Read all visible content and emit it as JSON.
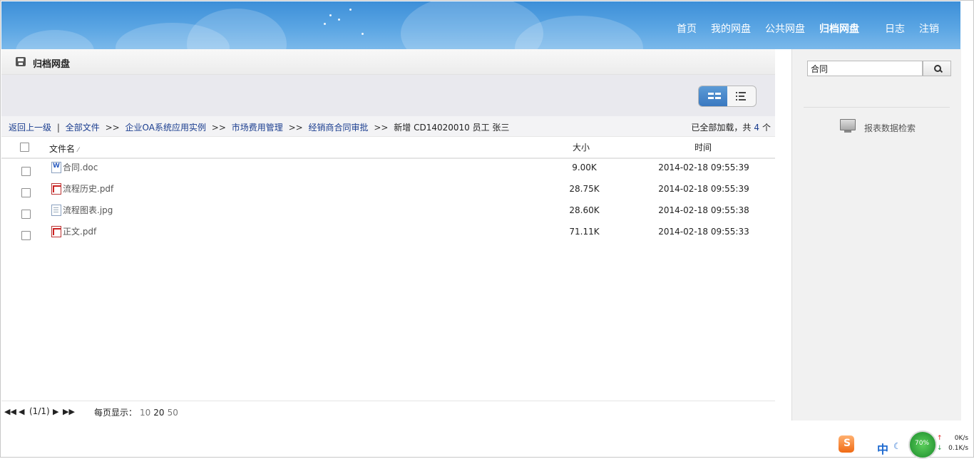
{
  "header": {
    "nav": [
      {
        "label": "首页",
        "active": false
      },
      {
        "label": "我的网盘",
        "active": false
      },
      {
        "label": "公共网盘",
        "active": false
      },
      {
        "label": "归档网盘",
        "active": true
      },
      {
        "label": "日志",
        "active": false
      },
      {
        "label": "注销",
        "active": false
      }
    ],
    "colors": {
      "sky_top": "#3d8fd8",
      "sky_bottom": "#7ab8ea"
    }
  },
  "panel": {
    "title": "归档网盘",
    "view_modes": {
      "selected": "grid-icon",
      "other": "list-icon"
    }
  },
  "breadcrumb": {
    "up": "返回上一级",
    "divider": "|",
    "items": [
      "全部文件",
      "企业OA系统应用实例",
      "市场费用管理",
      "经销商合同审批"
    ],
    "separator": ">>",
    "current": "新增 CD14020010 员工 张三"
  },
  "load_info": {
    "prefix": "已全部加载，共",
    "count": "4",
    "suffix": "个"
  },
  "table": {
    "columns": {
      "name": "文件名",
      "size": "大小",
      "time": "时间"
    },
    "rows": [
      {
        "icon": "word-doc-icon",
        "name": "合同.doc",
        "size": "9.00K",
        "time": "2014-02-18 09:55:39"
      },
      {
        "icon": "pdf-icon",
        "name": "流程历史.pdf",
        "size": "28.75K",
        "time": "2014-02-18 09:55:39"
      },
      {
        "icon": "image-file-icon",
        "name": "流程图表.jpg",
        "size": "28.60K",
        "time": "2014-02-18 09:55:38"
      },
      {
        "icon": "pdf-icon",
        "name": "正文.pdf",
        "size": "71.11K",
        "time": "2014-02-18 09:55:33"
      }
    ]
  },
  "pager": {
    "info": "(1/1)",
    "per_page_label": "每页显示：",
    "options": [
      "10",
      "20",
      "50"
    ],
    "selected": "20"
  },
  "sidebar": {
    "search_value": "合同",
    "report_search": "报表数据检索"
  },
  "tray": {
    "ime_logo": "S",
    "ime_lang": "中",
    "moon": "☾",
    "gauge": "70%",
    "upload": "0K/s",
    "download": "0.1K/s"
  }
}
